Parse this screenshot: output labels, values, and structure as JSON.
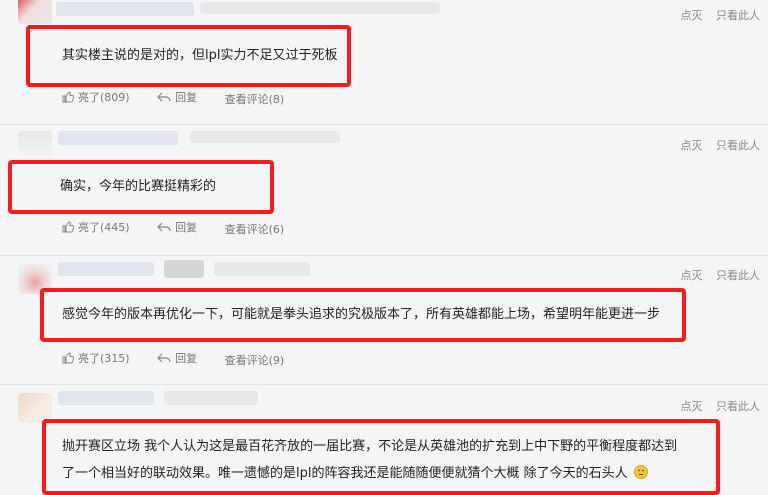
{
  "comments": [
    {
      "text": "其实楼主说的是对的，但lpl实力不足又过于死板",
      "like_label": "亮了",
      "like_count": "(809)",
      "reply_label": "回复",
      "view_comments_label": "查看评论",
      "view_comments_count": "(8)",
      "top_actions": {
        "dislike": "点灭",
        "only_this": "只看此人"
      }
    },
    {
      "text": "确实，今年的比赛挺精彩的",
      "like_label": "亮了",
      "like_count": "(445)",
      "reply_label": "回复",
      "view_comments_label": "查看评论",
      "view_comments_count": "(6)",
      "top_actions": {
        "dislike": "点灭",
        "only_this": "只看此人"
      }
    },
    {
      "text": "感觉今年的版本再优化一下，可能就是拳头追求的究极版本了，所有英雄都能上场，希望明年能更进一步",
      "like_label": "亮了",
      "like_count": "(315)",
      "reply_label": "回复",
      "view_comments_label": "查看评论",
      "view_comments_count": "(9)",
      "top_actions": {
        "dislike": "点灭",
        "only_this": "只看此人"
      }
    },
    {
      "text_line1": "抛开赛区立场 我个人认为这是最百花齐放的一届比赛，不论是从英雄池的扩充到上中下野的平衡程度都达到",
      "text_line2": "了一个相当好的联动效果。唯一遗憾的是lpl的阵容我还是能随随便便就猜个大概 除了今天的石头人",
      "emoji_icon": "thinking-face-emoji",
      "top_actions": {
        "dislike": "点灭",
        "only_this": "只看此人"
      }
    }
  ],
  "colors": {
    "highlight_border": "#ff1a1a",
    "background": "#f4f5f7",
    "divider": "#e3e3e3"
  }
}
